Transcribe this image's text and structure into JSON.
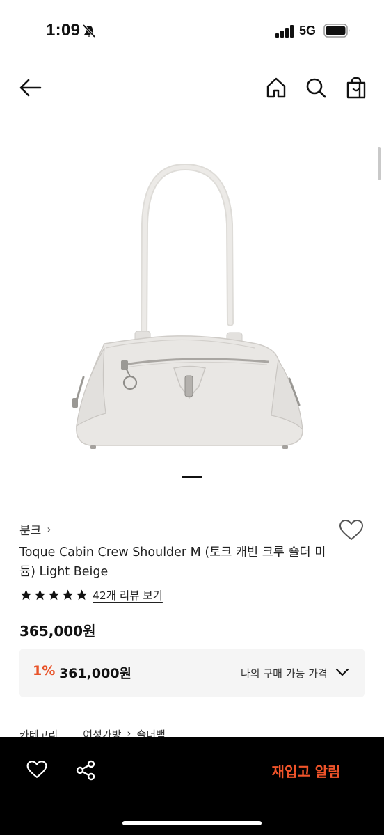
{
  "status_bar": {
    "time": "1:09",
    "network": "5G"
  },
  "icons": {
    "back": "arrow-left-icon",
    "home": "home-icon",
    "search": "search-icon",
    "bag": "shopping-bag-icon",
    "wishlist": "heart-icon",
    "share": "share-icon"
  },
  "product": {
    "brand": "분크",
    "brand_chevron": "›",
    "name": "Toque Cabin Crew Shoulder M (토크 캐빈 크루 숄더 미듐) Light Beige",
    "rating_stars": 5,
    "review_link": "42개 리뷰 보기",
    "price": "365,000원",
    "member_price": {
      "discount_rate": "1%",
      "discounted_price": "361,000원",
      "label": "나의 구매 가능 가격"
    },
    "category": {
      "label": "카테고리",
      "path": [
        "여성가방",
        "›",
        "숄더백"
      ]
    }
  },
  "carousel": {
    "current_slide": 3,
    "total_slides": 5
  },
  "bottom_bar": {
    "restock_label": "재입고 알림"
  },
  "colors": {
    "accent": "#e8542a",
    "price_box_bg": "#f5f5f5",
    "bottom_bar_bg": "#000000",
    "bag_color": "#e7e5e2"
  }
}
